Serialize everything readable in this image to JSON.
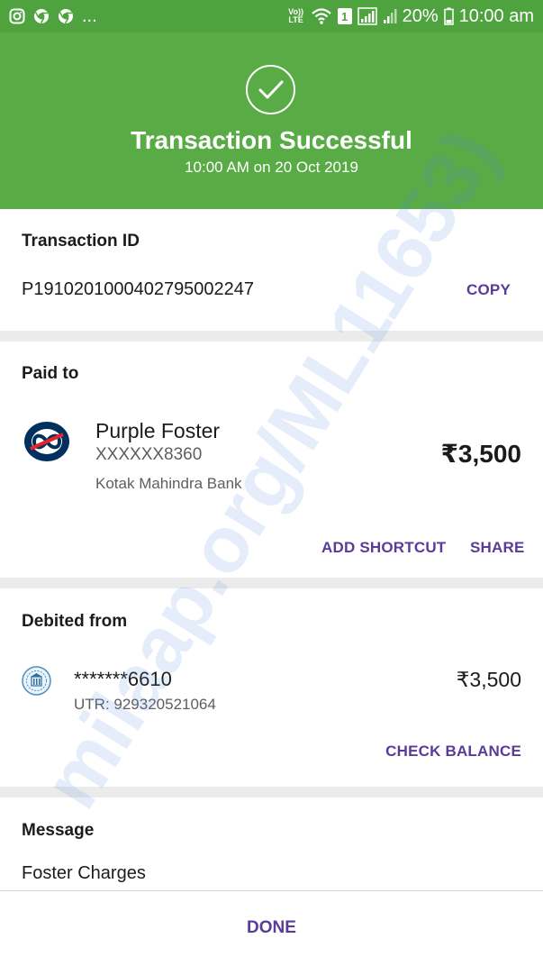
{
  "status_bar": {
    "left_more": "...",
    "lte_label": "Vo)) LTE",
    "sim_label": "1",
    "battery": "20%",
    "time": "10:00 am"
  },
  "header": {
    "title": "Transaction Successful",
    "subtitle": "10:00 AM on 20 Oct 2019",
    "icon": "checkmark-circle-icon",
    "bg_color": "#59ab46"
  },
  "transaction": {
    "label": "Transaction ID",
    "id": "P1910201000402795002247",
    "copy_label": "COPY"
  },
  "paid_to": {
    "label": "Paid to",
    "name": "Purple Foster",
    "account": "XXXXXX8360",
    "bank": "Kotak Mahindra Bank",
    "amount": "₹3,500",
    "add_shortcut_label": "ADD SHORTCUT",
    "share_label": "SHARE"
  },
  "debited_from": {
    "label": "Debited from",
    "account": "*******6610",
    "utr": "UTR: 929320521064",
    "amount": "₹3,500",
    "check_balance_label": "CHECK BALANCE"
  },
  "message": {
    "label": "Message",
    "text": "Foster Charges"
  },
  "footer": {
    "done_label": "DONE"
  },
  "watermark": "milaap.org/ML11653)",
  "colors": {
    "accent": "#5a3b9a",
    "success": "#59ab46",
    "kotak_blue": "#00305e",
    "kotak_red": "#e3242b"
  }
}
